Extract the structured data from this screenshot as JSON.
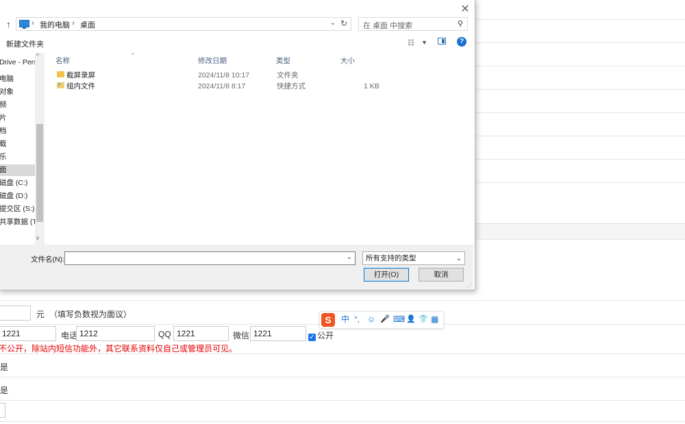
{
  "dialog": {
    "address": {
      "crumbs": [
        "我的电脑",
        "桌面"
      ],
      "separator": "›",
      "dropdown": "⌄",
      "refresh": "↻"
    },
    "search": {
      "placeholder": "在 桌面 中搜索",
      "icon": "search-icon"
    },
    "toolbar": {
      "new_folder": "新建文件夹",
      "help": "?"
    },
    "nav_items": [
      {
        "label": "Drive - Perso",
        "selected": false
      },
      {
        "label": "电脑",
        "selected": false
      },
      {
        "label": "对象",
        "selected": false
      },
      {
        "label": "频",
        "selected": false
      },
      {
        "label": "片",
        "selected": false
      },
      {
        "label": "档",
        "selected": false
      },
      {
        "label": "载",
        "selected": false
      },
      {
        "label": "乐",
        "selected": false
      },
      {
        "label": "面",
        "selected": true
      },
      {
        "label": "磁盘 (C:)",
        "selected": false
      },
      {
        "label": "磁盘 (D:)",
        "selected": false
      },
      {
        "label": "提交区 (S:)",
        "selected": false
      },
      {
        "label": "共享数据 (T",
        "selected": false
      }
    ],
    "columns": {
      "name": "名称",
      "modified": "修改日期",
      "type": "类型",
      "size": "大小"
    },
    "files": [
      {
        "name": "截屏录屏",
        "modified": "2024/11/8 10:17",
        "type": "文件夹",
        "size": "",
        "icon": "folder-icon"
      },
      {
        "name": "组内文件",
        "modified": "2024/11/8 8:17",
        "type": "快捷方式",
        "size": "1 KB",
        "icon": "shortcut-icon"
      }
    ],
    "filename_label": "文件名(N):",
    "filename_value": "",
    "filetype": "所有支持的类型",
    "open_button": "打开(O)",
    "cancel_button": "取消"
  },
  "page": {
    "amount_unit": "元",
    "amount_hint": "（填写负数视为面议）",
    "contact": {
      "field1_value": "1221",
      "phone_label": "电话",
      "phone_value": "1212",
      "qq_label": "QQ",
      "qq_value": "1221",
      "wechat_label": "微信",
      "wechat_value": "1221",
      "public_label": "公开",
      "public_checked": true
    },
    "privacy_notice": "不公开，除站内短信功能外，其它联系资料仅自己或管理员可见。",
    "row_a_value": "是",
    "row_b_value": "是"
  },
  "ime": {
    "logo": "S",
    "items": [
      "中",
      "°,",
      "☺",
      "🎤",
      "⌨",
      "👤",
      "👕",
      "▦"
    ]
  }
}
